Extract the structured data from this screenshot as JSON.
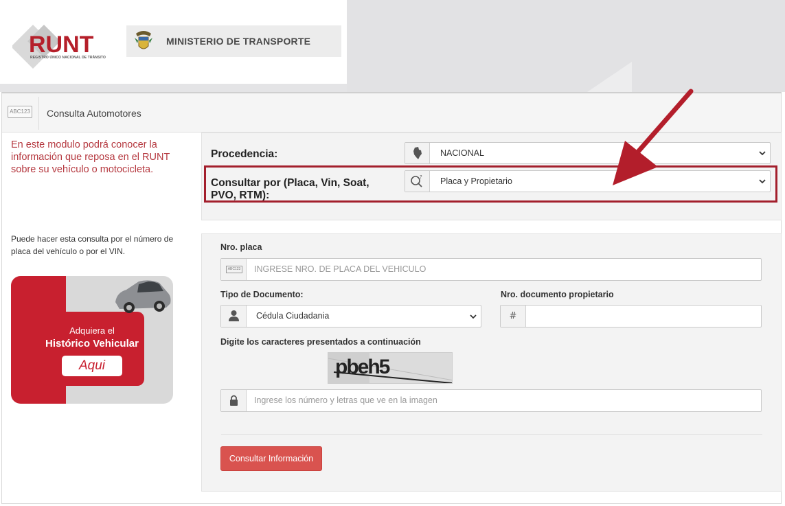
{
  "header": {
    "logo_word": "RUNT",
    "logo_subtitle": "REGISTRO ÚNICO NACIONAL DE TRÁNSITO",
    "ministry": "MINISTERIO DE TRANSPORTE"
  },
  "titlebar": {
    "icon_text": "ABC123",
    "title": "Consulta Automotores"
  },
  "left": {
    "intro": "En este modulo podrá conocer la información que reposa en el RUNT sobre su vehículo o motocicleta.",
    "note": "Puede hacer esta consulta por el número de placa del vehículo o por el VIN.",
    "promo": {
      "line1": "Adquiera el",
      "line2": "Histórico Vehicular",
      "button": "Aqui"
    }
  },
  "query": {
    "procedencia_label": "Procedencia:",
    "procedencia_value": "NACIONAL",
    "consultar_label": "Consultar por (Placa, Vin, Soat, PVO, RTM):",
    "consultar_value": "Placa y Propietario"
  },
  "form": {
    "placa_label": "Nro. placa",
    "placa_icon_text": "ABC123",
    "placa_placeholder": "INGRESE NRO. DE PLACA DEL VEHICULO",
    "tipo_doc_label": "Tipo de Documento:",
    "tipo_doc_value": "Cédula Ciudadania",
    "nro_doc_label": "Nro. documento propietario",
    "nro_doc_icon": "#",
    "captcha_label": "Digite los caracteres presentados a continuación",
    "captcha_text": "pbeh5",
    "captcha_placeholder": "Ingrese los número y letras que ve en la imagen",
    "submit": "Consultar Información"
  },
  "colors": {
    "brand_red": "#b51f2a",
    "highlight_border": "#a31f2c",
    "submit_bg": "#d9534f",
    "intro_text": "#b5383f"
  },
  "icons": {
    "procedencia": "colombia-map-icon",
    "consultar": "search-icon",
    "tipo_doc": "user-icon",
    "captcha": "lock-icon",
    "annotation": "red-arrow-icon"
  }
}
